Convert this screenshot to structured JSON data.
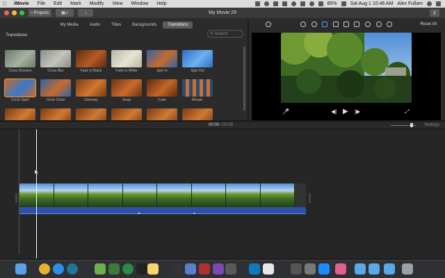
{
  "menubar": {
    "app_name": "iMovie",
    "items": [
      "File",
      "Edit",
      "Mark",
      "Modify",
      "View",
      "Window",
      "Help"
    ],
    "battery": "85%",
    "clock": "Sat Aug 1  10:46 AM",
    "user": "Alex Fullam"
  },
  "titlebar": {
    "projects_label": "Projects",
    "window_title": "My Movie 29"
  },
  "browser": {
    "tabs": [
      "My Media",
      "Audio",
      "Titles",
      "Backgrounds",
      "Transitions"
    ],
    "active_tab": "Transitions",
    "section_title": "Transitions",
    "search_placeholder": "Search",
    "transitions": [
      {
        "label": "Cross Dissolve",
        "style": "forest"
      },
      {
        "label": "Cross Blur",
        "style": "forest-blur"
      },
      {
        "label": "Fade to Black",
        "style": "canyon-dark"
      },
      {
        "label": "Fade to White",
        "style": "forest-light"
      },
      {
        "label": "Spin In",
        "style": "canyon-spin"
      },
      {
        "label": "Spin Out",
        "style": "sky-spin"
      },
      {
        "label": "Circle Open",
        "style": "sky-circle",
        "selected": true
      },
      {
        "label": "Circle Close",
        "style": "canyon-circle"
      },
      {
        "label": "Doorway",
        "style": "canyon-door"
      },
      {
        "label": "Swap",
        "style": "canyon-swap"
      },
      {
        "label": "Cube",
        "style": "canyon-cube"
      },
      {
        "label": "Mosaic",
        "style": "mosaic"
      },
      {
        "label": "",
        "style": "canyon"
      },
      {
        "label": "",
        "style": "canyon"
      },
      {
        "label": "",
        "style": "canyon"
      },
      {
        "label": "",
        "style": "canyon"
      },
      {
        "label": "",
        "style": "canyon"
      },
      {
        "label": "",
        "style": "canyon"
      }
    ]
  },
  "viewer": {
    "reset_all": "Reset All",
    "adjust_icons": [
      "enhance-icon",
      "color-balance-icon",
      "color-correction-icon",
      "crop-icon",
      "stabilization-icon",
      "volume-icon",
      "noise-reduction-icon",
      "speed-icon",
      "clip-filter-icon",
      "info-icon"
    ]
  },
  "timeline": {
    "current_time": "00:00",
    "separator": "/",
    "total_time": "00:08",
    "settings_label": "Settings",
    "frame_count": 8
  },
  "dock": {
    "icons": [
      "finder",
      "chrome",
      "safari",
      "wordpress",
      "maps",
      "system-uninstaller",
      "onyx",
      "terminal",
      "notes",
      "scanner",
      "preview",
      "photo-booth",
      "imovie",
      "archive",
      "trello",
      "lists",
      "file-merge",
      "disk-utility",
      "app-store",
      "photos",
      "folder",
      "folder-2",
      "downloads",
      "trash"
    ]
  },
  "colors": {
    "accent": "#f0a030",
    "audio_track": "#2e4fa8",
    "active_tab": "#5c5c5c"
  }
}
